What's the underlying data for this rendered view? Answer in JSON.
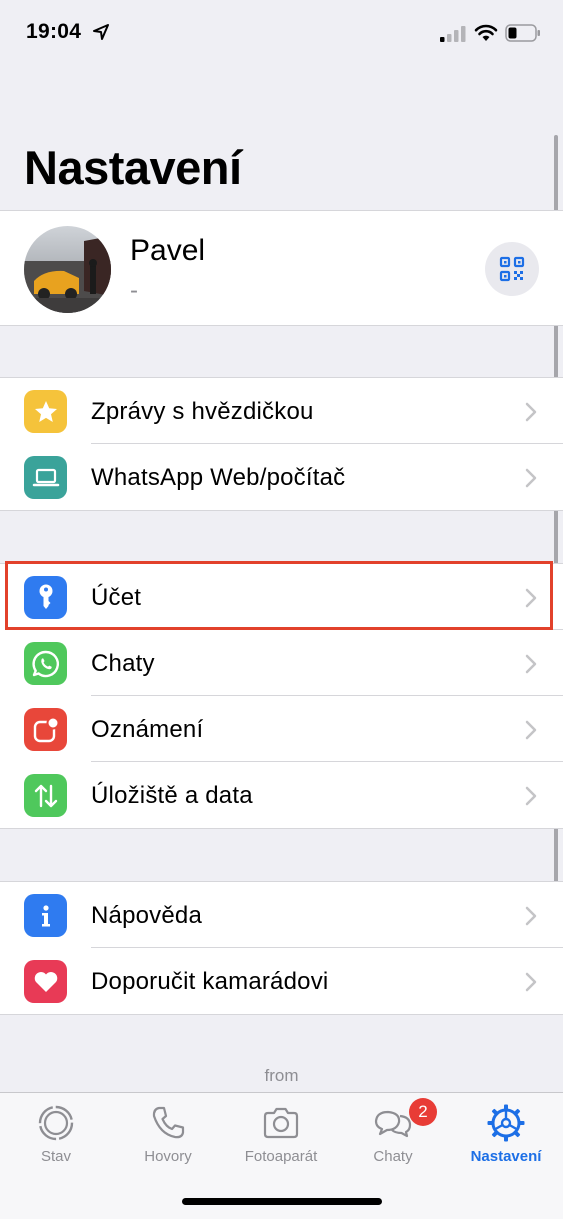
{
  "status_bar": {
    "time": "19:04"
  },
  "title": "Nastavení",
  "profile": {
    "name": "Pavel",
    "status": "-"
  },
  "group1": [
    {
      "label": "Zprávy s hvězdičkou",
      "icon": "star-icon",
      "color": "#f5c33b"
    },
    {
      "label": "WhatsApp Web/počítač",
      "icon": "laptop-icon",
      "color": "#3aa39a"
    }
  ],
  "group2": [
    {
      "label": "Účet",
      "icon": "key-icon",
      "color": "#2f7bf0"
    },
    {
      "label": "Chaty",
      "icon": "whatsapp-icon",
      "color": "#4fc85c"
    },
    {
      "label": "Oznámení",
      "icon": "notification-icon",
      "color": "#e8473a"
    },
    {
      "label": "Úložiště a data",
      "icon": "storage-arrows-icon",
      "color": "#4fc85c"
    }
  ],
  "group3": [
    {
      "label": "Nápověda",
      "icon": "info-icon",
      "color": "#2f7bf0"
    },
    {
      "label": "Doporučit kamarádovi",
      "icon": "heart-icon",
      "color": "#e83a56"
    }
  ],
  "footer": "from",
  "tabs": [
    {
      "label": "Stav",
      "icon": "status-icon"
    },
    {
      "label": "Hovory",
      "icon": "phone-icon"
    },
    {
      "label": "Fotoaparát",
      "icon": "camera-icon"
    },
    {
      "label": "Chaty",
      "icon": "chat-bubbles-icon",
      "badge": "2"
    },
    {
      "label": "Nastavení",
      "icon": "settings-gear-icon",
      "active": true
    }
  ],
  "colors": {
    "accent": "#1d6fe6",
    "highlight": "#e2412b",
    "badge": "#e83c36"
  }
}
